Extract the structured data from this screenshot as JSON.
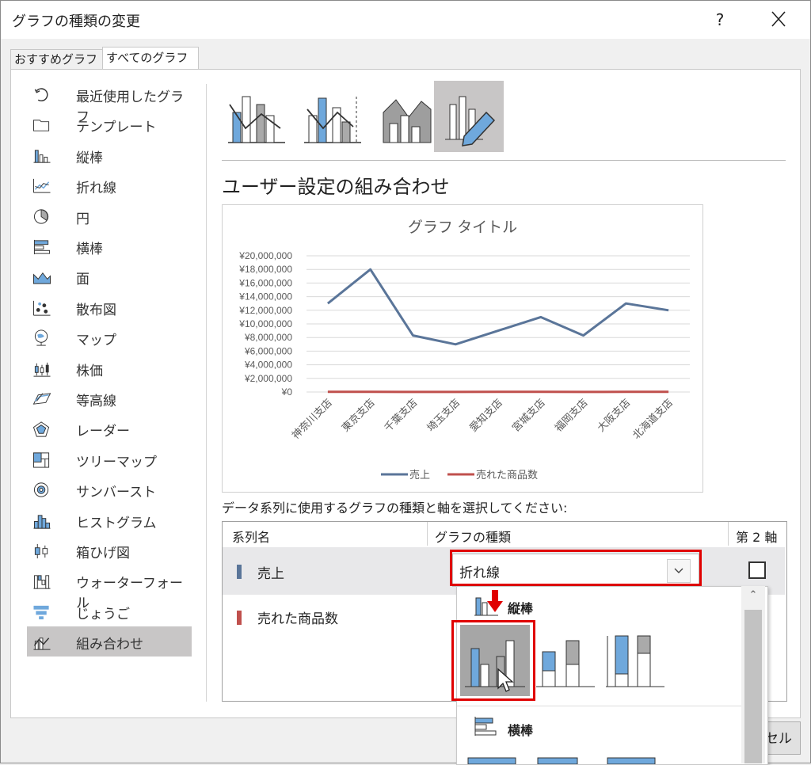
{
  "dialog": {
    "title": "グラフの種類の変更",
    "help": "?",
    "tabs": [
      "おすすめグラフ",
      "すべてのグラフ"
    ]
  },
  "sidebar": {
    "items": [
      {
        "label": "最近使用したグラフ",
        "icon": "recent-icon"
      },
      {
        "label": "テンプレート",
        "icon": "folder-icon"
      },
      {
        "label": "縦棒",
        "icon": "column-chart-icon"
      },
      {
        "label": "折れ線",
        "icon": "line-chart-icon"
      },
      {
        "label": "円",
        "icon": "pie-chart-icon"
      },
      {
        "label": "横棒",
        "icon": "bar-chart-icon"
      },
      {
        "label": "面",
        "icon": "area-chart-icon"
      },
      {
        "label": "散布図",
        "icon": "scatter-chart-icon"
      },
      {
        "label": "マップ",
        "icon": "map-chart-icon"
      },
      {
        "label": "株価",
        "icon": "stock-chart-icon"
      },
      {
        "label": "等高線",
        "icon": "surface-chart-icon"
      },
      {
        "label": "レーダー",
        "icon": "radar-chart-icon"
      },
      {
        "label": "ツリーマップ",
        "icon": "treemap-chart-icon"
      },
      {
        "label": "サンバースト",
        "icon": "sunburst-chart-icon"
      },
      {
        "label": "ヒストグラム",
        "icon": "histogram-chart-icon"
      },
      {
        "label": "箱ひげ図",
        "icon": "boxwhisker-chart-icon"
      },
      {
        "label": "ウォーターフォール",
        "icon": "waterfall-chart-icon"
      },
      {
        "label": "じょうご",
        "icon": "funnel-chart-icon"
      },
      {
        "label": "組み合わせ",
        "icon": "combo-chart-icon"
      }
    ],
    "selected": "組み合わせ"
  },
  "main": {
    "section_title": "ユーザー設定の組み合わせ",
    "series_instruction": "データ系列に使用するグラフの種類と軸を選択してください:",
    "table_headers": {
      "name": "系列名",
      "type": "グラフの種類",
      "axis": "第 2 軸"
    },
    "series": [
      {
        "name": "売上",
        "type": "折れ線",
        "color": "#5a7599"
      },
      {
        "name": "売れた商品数",
        "color": "#c0504d"
      }
    ]
  },
  "dropdown": {
    "groups": [
      "縦棒",
      "横棒"
    ]
  },
  "buttons": {
    "cancel_visible": "セル"
  },
  "colors": {
    "accent_blue": "#6fa8dc",
    "highlight_red": "#e00000",
    "selected_bg": "#c8c6c6"
  },
  "chart_data": {
    "type": "line",
    "title": "グラフ タイトル",
    "categories": [
      "神奈川支店",
      "東京支店",
      "千葉支店",
      "埼玉支店",
      "愛知支店",
      "宮城支店",
      "福岡支店",
      "大阪支店",
      "北海道支店"
    ],
    "series": [
      {
        "name": "売上",
        "color": "#5a7599",
        "values": [
          13000000,
          18000000,
          8300000,
          7000000,
          9000000,
          11000000,
          8300000,
          13000000,
          12000000
        ]
      },
      {
        "name": "売れた商品数",
        "color": "#c0504d",
        "values": [
          30000,
          25000,
          20000,
          18000,
          30000,
          22000,
          18000,
          25000,
          28000
        ]
      }
    ],
    "yticks": [
      "¥0",
      "¥2,000,000",
      "¥4,000,000",
      "¥6,000,000",
      "¥8,000,000",
      "¥10,000,000",
      "¥12,000,000",
      "¥14,000,000",
      "¥16,000,000",
      "¥18,000,000",
      "¥20,000,000"
    ],
    "ylim": [
      0,
      20000000
    ],
    "grid": true,
    "legend": "bottom"
  }
}
